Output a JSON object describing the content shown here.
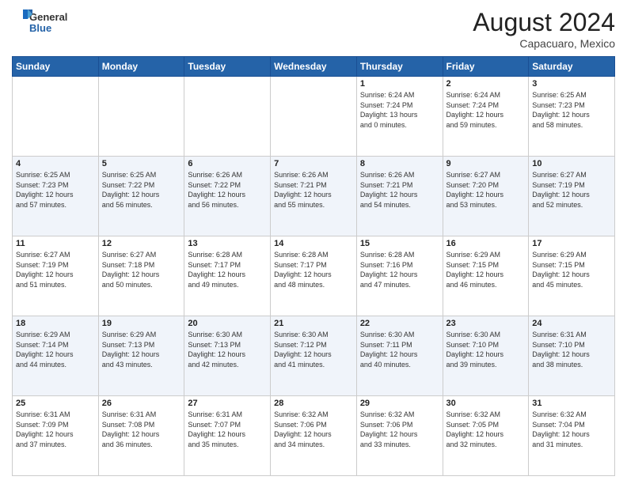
{
  "header": {
    "logo_general": "General",
    "logo_blue": "Blue",
    "month_year": "August 2024",
    "location": "Capacuaro, Mexico"
  },
  "weekdays": [
    "Sunday",
    "Monday",
    "Tuesday",
    "Wednesday",
    "Thursday",
    "Friday",
    "Saturday"
  ],
  "weeks": [
    [
      {
        "day": "",
        "info": ""
      },
      {
        "day": "",
        "info": ""
      },
      {
        "day": "",
        "info": ""
      },
      {
        "day": "",
        "info": ""
      },
      {
        "day": "1",
        "info": "Sunrise: 6:24 AM\nSunset: 7:24 PM\nDaylight: 13 hours\nand 0 minutes."
      },
      {
        "day": "2",
        "info": "Sunrise: 6:24 AM\nSunset: 7:24 PM\nDaylight: 12 hours\nand 59 minutes."
      },
      {
        "day": "3",
        "info": "Sunrise: 6:25 AM\nSunset: 7:23 PM\nDaylight: 12 hours\nand 58 minutes."
      }
    ],
    [
      {
        "day": "4",
        "info": "Sunrise: 6:25 AM\nSunset: 7:23 PM\nDaylight: 12 hours\nand 57 minutes."
      },
      {
        "day": "5",
        "info": "Sunrise: 6:25 AM\nSunset: 7:22 PM\nDaylight: 12 hours\nand 56 minutes."
      },
      {
        "day": "6",
        "info": "Sunrise: 6:26 AM\nSunset: 7:22 PM\nDaylight: 12 hours\nand 56 minutes."
      },
      {
        "day": "7",
        "info": "Sunrise: 6:26 AM\nSunset: 7:21 PM\nDaylight: 12 hours\nand 55 minutes."
      },
      {
        "day": "8",
        "info": "Sunrise: 6:26 AM\nSunset: 7:21 PM\nDaylight: 12 hours\nand 54 minutes."
      },
      {
        "day": "9",
        "info": "Sunrise: 6:27 AM\nSunset: 7:20 PM\nDaylight: 12 hours\nand 53 minutes."
      },
      {
        "day": "10",
        "info": "Sunrise: 6:27 AM\nSunset: 7:19 PM\nDaylight: 12 hours\nand 52 minutes."
      }
    ],
    [
      {
        "day": "11",
        "info": "Sunrise: 6:27 AM\nSunset: 7:19 PM\nDaylight: 12 hours\nand 51 minutes."
      },
      {
        "day": "12",
        "info": "Sunrise: 6:27 AM\nSunset: 7:18 PM\nDaylight: 12 hours\nand 50 minutes."
      },
      {
        "day": "13",
        "info": "Sunrise: 6:28 AM\nSunset: 7:17 PM\nDaylight: 12 hours\nand 49 minutes."
      },
      {
        "day": "14",
        "info": "Sunrise: 6:28 AM\nSunset: 7:17 PM\nDaylight: 12 hours\nand 48 minutes."
      },
      {
        "day": "15",
        "info": "Sunrise: 6:28 AM\nSunset: 7:16 PM\nDaylight: 12 hours\nand 47 minutes."
      },
      {
        "day": "16",
        "info": "Sunrise: 6:29 AM\nSunset: 7:15 PM\nDaylight: 12 hours\nand 46 minutes."
      },
      {
        "day": "17",
        "info": "Sunrise: 6:29 AM\nSunset: 7:15 PM\nDaylight: 12 hours\nand 45 minutes."
      }
    ],
    [
      {
        "day": "18",
        "info": "Sunrise: 6:29 AM\nSunset: 7:14 PM\nDaylight: 12 hours\nand 44 minutes."
      },
      {
        "day": "19",
        "info": "Sunrise: 6:29 AM\nSunset: 7:13 PM\nDaylight: 12 hours\nand 43 minutes."
      },
      {
        "day": "20",
        "info": "Sunrise: 6:30 AM\nSunset: 7:13 PM\nDaylight: 12 hours\nand 42 minutes."
      },
      {
        "day": "21",
        "info": "Sunrise: 6:30 AM\nSunset: 7:12 PM\nDaylight: 12 hours\nand 41 minutes."
      },
      {
        "day": "22",
        "info": "Sunrise: 6:30 AM\nSunset: 7:11 PM\nDaylight: 12 hours\nand 40 minutes."
      },
      {
        "day": "23",
        "info": "Sunrise: 6:30 AM\nSunset: 7:10 PM\nDaylight: 12 hours\nand 39 minutes."
      },
      {
        "day": "24",
        "info": "Sunrise: 6:31 AM\nSunset: 7:10 PM\nDaylight: 12 hours\nand 38 minutes."
      }
    ],
    [
      {
        "day": "25",
        "info": "Sunrise: 6:31 AM\nSunset: 7:09 PM\nDaylight: 12 hours\nand 37 minutes."
      },
      {
        "day": "26",
        "info": "Sunrise: 6:31 AM\nSunset: 7:08 PM\nDaylight: 12 hours\nand 36 minutes."
      },
      {
        "day": "27",
        "info": "Sunrise: 6:31 AM\nSunset: 7:07 PM\nDaylight: 12 hours\nand 35 minutes."
      },
      {
        "day": "28",
        "info": "Sunrise: 6:32 AM\nSunset: 7:06 PM\nDaylight: 12 hours\nand 34 minutes."
      },
      {
        "day": "29",
        "info": "Sunrise: 6:32 AM\nSunset: 7:06 PM\nDaylight: 12 hours\nand 33 minutes."
      },
      {
        "day": "30",
        "info": "Sunrise: 6:32 AM\nSunset: 7:05 PM\nDaylight: 12 hours\nand 32 minutes."
      },
      {
        "day": "31",
        "info": "Sunrise: 6:32 AM\nSunset: 7:04 PM\nDaylight: 12 hours\nand 31 minutes."
      }
    ]
  ]
}
